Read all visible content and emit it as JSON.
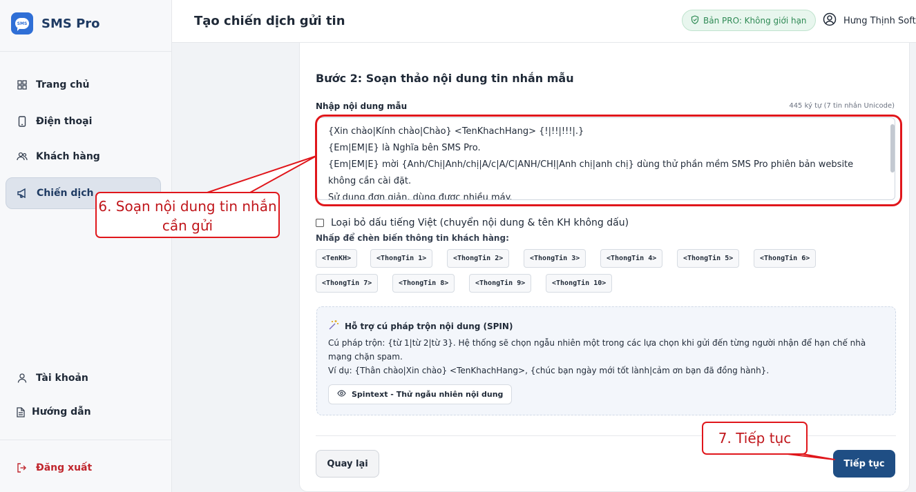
{
  "brand": {
    "logo_text": "SMS",
    "name": "SMS Pro"
  },
  "sidebar": {
    "items": [
      {
        "label": "Trang chủ",
        "icon": "grid-icon"
      },
      {
        "label": "Điện thoại",
        "icon": "phone-icon"
      },
      {
        "label": "Khách hàng",
        "icon": "users-icon"
      },
      {
        "label": "Chiến dịch",
        "icon": "megaphone-icon",
        "active": true
      },
      {
        "label": "Tài khoản",
        "icon": "user-icon"
      },
      {
        "label": "Hướng dẫn",
        "icon": "document-icon"
      },
      {
        "label": "Đăng xuất",
        "icon": "logout-icon"
      }
    ]
  },
  "header": {
    "title": "Tạo chiến dịch gửi tin",
    "pro_badge": "Bản PRO: Không giới hạn",
    "user_name": "Hưng Thịnh Soft"
  },
  "form": {
    "step_title": "Bước 2: Soạn thảo nội dung tin nhắn mẫu",
    "field_label": "Nhập nội dung mẫu",
    "char_count": "445 ký tự (7 tin nhắn Unicode)",
    "message_value": "{Xin chào|Kính chào|Chào} <TenKhachHang> {!|!!|!!!|.}\n{Em|EM|E} là Nghĩa bên SMS Pro.\n{Em|EM|E} mời {Anh/Chị|Anh/chị|A/c|A/C|ANH/CHỊ|Anh chị|anh chị} dùng thử phần mềm SMS Pro phiên bản website không cần cài đặt.\nSử dụng đơn giản, dùng được nhiều máy.",
    "checkbox_label": "Loại bỏ dấu tiếng Việt (chuyển nội dung & tên KH không dấu)",
    "checkbox_checked": false,
    "chips_label": "Nhấp để chèn biến thông tin khách hàng:",
    "chips": [
      "<TenKH>",
      "<ThongTin 1>",
      "<ThongTin 2>",
      "<ThongTin 3>",
      "<ThongTin 4>",
      "<ThongTin 5>",
      "<ThongTin 6>",
      "<ThongTin 7>",
      "<ThongTin 8>",
      "<ThongTin 9>",
      "<ThongTin 10>"
    ]
  },
  "spin": {
    "title": "Hỗ trợ cú pháp trộn nội dung (SPIN)",
    "syntax": "Cú pháp trộn: {từ 1|từ 2|từ 3}. Hệ thống sẽ chọn ngẫu nhiên một trong các lựa chọn khi gửi đến từng người nhận để hạn chế nhà mạng chặn spam.",
    "example": "Ví dụ: {Thân chào|Xin chào} <TenKhachHang>, {chúc bạn ngày mới tốt lành|cảm ơn bạn đã đồng hành}.",
    "button": "Spintext - Thử ngẫu nhiên nội dung"
  },
  "actions": {
    "back": "Quay lại",
    "next": "Tiếp tục"
  },
  "annotations": {
    "callout_compose": "6. Soạn nội dung tin nhắn cần gửi",
    "callout_next": "7. Tiếp tục",
    "color": "#e0161b"
  },
  "colors": {
    "accent": "#1f4e84",
    "pro_badge": "#2f8a55",
    "logout": "#c0262d"
  }
}
